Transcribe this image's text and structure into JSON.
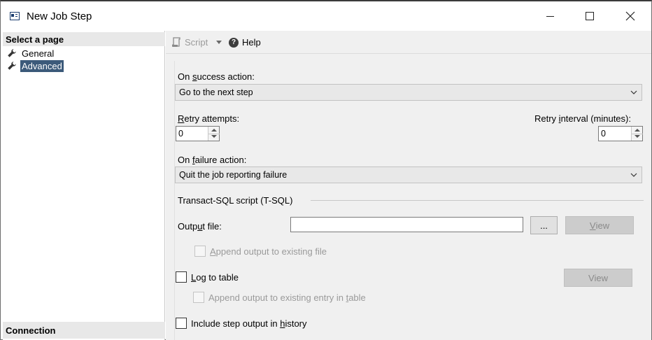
{
  "window": {
    "title": "New Job Step"
  },
  "sidebar": {
    "select_page_header": "Select a page",
    "items": [
      {
        "label": "General",
        "selected": false
      },
      {
        "label": "Advanced",
        "selected": true
      }
    ],
    "connection_header": "Connection"
  },
  "toolbar": {
    "script_label": "Script",
    "help_label": "Help"
  },
  "form": {
    "on_success_label_pre": "On ",
    "on_success_label_u": "s",
    "on_success_label_post": "uccess action:",
    "on_success_value": "Go to the next step",
    "retry_attempts_label_u": "R",
    "retry_attempts_label_post": "etry attempts:",
    "retry_attempts_value": "0",
    "retry_interval_label_pre": "Retry ",
    "retry_interval_label_u": "i",
    "retry_interval_label_post": "nterval (minutes):",
    "retry_interval_value": "0",
    "on_failure_label_pre": "On ",
    "on_failure_label_u": "f",
    "on_failure_label_post": "ailure action:",
    "on_failure_value": "Quit the job reporting failure",
    "tsql_section_label": "Transact-SQL script (T-SQL)",
    "output_file_label_pre": "Outp",
    "output_file_label_u": "u",
    "output_file_label_post": "t file:",
    "output_file_value": "",
    "browse_label": "...",
    "view_label_pre": "",
    "view_label_u": "V",
    "view_label_post": "iew",
    "append_output_label_u": "A",
    "append_output_label_post": "ppend output to existing file",
    "log_to_table_label_u": "L",
    "log_to_table_label_post": "og to table",
    "view2_label": "View",
    "append_entry_label_pre": "Append output to existing entry in ",
    "append_entry_label_u": "t",
    "append_entry_label_post": "able",
    "include_history_label_pre": "Include step output in ",
    "include_history_label_u": "h",
    "include_history_label_post": "istory"
  },
  "colors": {
    "selection_bg": "#3c5a7a",
    "panel_bg": "#f0f0f0",
    "header_bg": "#e8e8e8"
  },
  "icons": {
    "app": "window-icon",
    "nav": "wrench-icon",
    "script": "script-icon",
    "help": "help-icon",
    "dropdown": "chevron-down-icon"
  }
}
